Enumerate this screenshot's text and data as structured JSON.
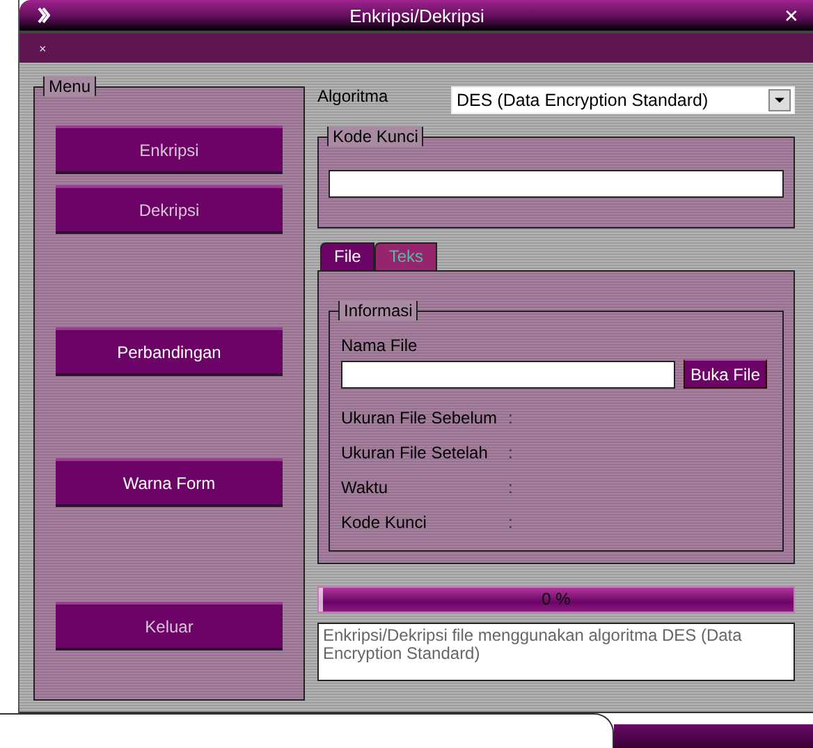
{
  "window": {
    "title": "Enkripsi/Dekripsi",
    "menu_mark": "×",
    "close": "✕"
  },
  "menu": {
    "title": "Menu",
    "buttons": [
      {
        "label": "Enkripsi",
        "dim": true
      },
      {
        "label": "Dekripsi",
        "dim": true
      },
      {
        "label": "Perbandingan",
        "dim": false
      },
      {
        "label": "Warna Form",
        "dim": false
      },
      {
        "label": "Keluar",
        "dim": true
      }
    ]
  },
  "algorithm": {
    "label": "Algoritma",
    "value": "DES (Data Encryption Standard)"
  },
  "key_group": {
    "title": "Kode Kunci"
  },
  "tabs": [
    {
      "label": "File",
      "selected": true
    },
    {
      "label": "Teks",
      "selected": false
    }
  ],
  "info": {
    "title": "Informasi",
    "file_label": "Nama File",
    "browse_button": "Buka File",
    "rows": [
      {
        "label": "Ukuran File Sebelum",
        "sep": ":"
      },
      {
        "label": "Ukuran File Setelah",
        "sep": ":"
      },
      {
        "label": "Waktu",
        "sep": ":"
      },
      {
        "label": "Kode Kunci",
        "sep": ":"
      }
    ]
  },
  "progress": {
    "level": 0.0,
    "text": "0 %"
  },
  "status": "Enkripsi/Dekripsi file menggunakan algoritma DES (Data Encryption Standard)"
}
